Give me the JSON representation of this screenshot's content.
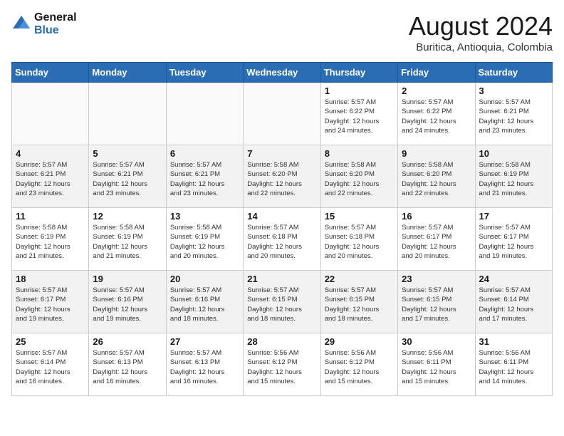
{
  "header": {
    "logo_line1": "General",
    "logo_line2": "Blue",
    "title": "August 2024",
    "subtitle": "Buritica, Antioquia, Colombia"
  },
  "columns": [
    "Sunday",
    "Monday",
    "Tuesday",
    "Wednesday",
    "Thursday",
    "Friday",
    "Saturday"
  ],
  "weeks": [
    [
      {
        "day": "",
        "info": ""
      },
      {
        "day": "",
        "info": ""
      },
      {
        "day": "",
        "info": ""
      },
      {
        "day": "",
        "info": ""
      },
      {
        "day": "1",
        "info": "Sunrise: 5:57 AM\nSunset: 6:22 PM\nDaylight: 12 hours\nand 24 minutes."
      },
      {
        "day": "2",
        "info": "Sunrise: 5:57 AM\nSunset: 6:22 PM\nDaylight: 12 hours\nand 24 minutes."
      },
      {
        "day": "3",
        "info": "Sunrise: 5:57 AM\nSunset: 6:21 PM\nDaylight: 12 hours\nand 23 minutes."
      }
    ],
    [
      {
        "day": "4",
        "info": "Sunrise: 5:57 AM\nSunset: 6:21 PM\nDaylight: 12 hours\nand 23 minutes."
      },
      {
        "day": "5",
        "info": "Sunrise: 5:57 AM\nSunset: 6:21 PM\nDaylight: 12 hours\nand 23 minutes."
      },
      {
        "day": "6",
        "info": "Sunrise: 5:57 AM\nSunset: 6:21 PM\nDaylight: 12 hours\nand 23 minutes."
      },
      {
        "day": "7",
        "info": "Sunrise: 5:58 AM\nSunset: 6:20 PM\nDaylight: 12 hours\nand 22 minutes."
      },
      {
        "day": "8",
        "info": "Sunrise: 5:58 AM\nSunset: 6:20 PM\nDaylight: 12 hours\nand 22 minutes."
      },
      {
        "day": "9",
        "info": "Sunrise: 5:58 AM\nSunset: 6:20 PM\nDaylight: 12 hours\nand 22 minutes."
      },
      {
        "day": "10",
        "info": "Sunrise: 5:58 AM\nSunset: 6:19 PM\nDaylight: 12 hours\nand 21 minutes."
      }
    ],
    [
      {
        "day": "11",
        "info": "Sunrise: 5:58 AM\nSunset: 6:19 PM\nDaylight: 12 hours\nand 21 minutes."
      },
      {
        "day": "12",
        "info": "Sunrise: 5:58 AM\nSunset: 6:19 PM\nDaylight: 12 hours\nand 21 minutes."
      },
      {
        "day": "13",
        "info": "Sunrise: 5:58 AM\nSunset: 6:19 PM\nDaylight: 12 hours\nand 20 minutes."
      },
      {
        "day": "14",
        "info": "Sunrise: 5:57 AM\nSunset: 6:18 PM\nDaylight: 12 hours\nand 20 minutes."
      },
      {
        "day": "15",
        "info": "Sunrise: 5:57 AM\nSunset: 6:18 PM\nDaylight: 12 hours\nand 20 minutes."
      },
      {
        "day": "16",
        "info": "Sunrise: 5:57 AM\nSunset: 6:17 PM\nDaylight: 12 hours\nand 20 minutes."
      },
      {
        "day": "17",
        "info": "Sunrise: 5:57 AM\nSunset: 6:17 PM\nDaylight: 12 hours\nand 19 minutes."
      }
    ],
    [
      {
        "day": "18",
        "info": "Sunrise: 5:57 AM\nSunset: 6:17 PM\nDaylight: 12 hours\nand 19 minutes."
      },
      {
        "day": "19",
        "info": "Sunrise: 5:57 AM\nSunset: 6:16 PM\nDaylight: 12 hours\nand 19 minutes."
      },
      {
        "day": "20",
        "info": "Sunrise: 5:57 AM\nSunset: 6:16 PM\nDaylight: 12 hours\nand 18 minutes."
      },
      {
        "day": "21",
        "info": "Sunrise: 5:57 AM\nSunset: 6:15 PM\nDaylight: 12 hours\nand 18 minutes."
      },
      {
        "day": "22",
        "info": "Sunrise: 5:57 AM\nSunset: 6:15 PM\nDaylight: 12 hours\nand 18 minutes."
      },
      {
        "day": "23",
        "info": "Sunrise: 5:57 AM\nSunset: 6:15 PM\nDaylight: 12 hours\nand 17 minutes."
      },
      {
        "day": "24",
        "info": "Sunrise: 5:57 AM\nSunset: 6:14 PM\nDaylight: 12 hours\nand 17 minutes."
      }
    ],
    [
      {
        "day": "25",
        "info": "Sunrise: 5:57 AM\nSunset: 6:14 PM\nDaylight: 12 hours\nand 16 minutes."
      },
      {
        "day": "26",
        "info": "Sunrise: 5:57 AM\nSunset: 6:13 PM\nDaylight: 12 hours\nand 16 minutes."
      },
      {
        "day": "27",
        "info": "Sunrise: 5:57 AM\nSunset: 6:13 PM\nDaylight: 12 hours\nand 16 minutes."
      },
      {
        "day": "28",
        "info": "Sunrise: 5:56 AM\nSunset: 6:12 PM\nDaylight: 12 hours\nand 15 minutes."
      },
      {
        "day": "29",
        "info": "Sunrise: 5:56 AM\nSunset: 6:12 PM\nDaylight: 12 hours\nand 15 minutes."
      },
      {
        "day": "30",
        "info": "Sunrise: 5:56 AM\nSunset: 6:11 PM\nDaylight: 12 hours\nand 15 minutes."
      },
      {
        "day": "31",
        "info": "Sunrise: 5:56 AM\nSunset: 6:11 PM\nDaylight: 12 hours\nand 14 minutes."
      }
    ]
  ]
}
